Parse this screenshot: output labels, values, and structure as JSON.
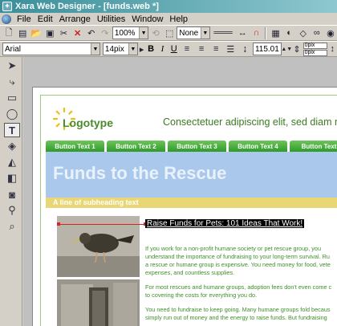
{
  "window": {
    "title": "Xara Web Designer - [funds.web *]"
  },
  "menu": [
    "File",
    "Edit",
    "Arrange",
    "Utilities",
    "Window",
    "Help"
  ],
  "toolbar": {
    "zoom": "100%",
    "fill": "None",
    "width_value": "115.01",
    "x_value": "0pix",
    "y_value": "0pix"
  },
  "textbar": {
    "font": "Arial",
    "size": "14pix",
    "bold": "B",
    "italic": "I",
    "underline": "U"
  },
  "tools": [
    "selector",
    "shape-editor",
    "rectangle",
    "ellipse",
    "text",
    "fill",
    "transparency",
    "shadow",
    "photo",
    "link",
    "zoom"
  ],
  "site": {
    "logotype": "Logotype",
    "tagline": "Consectetuer adipiscing elit, sed diam nonur",
    "nav": [
      "Button Text 1",
      "Button Text 2",
      "Button Text 3",
      "Button Text 4",
      "Button Text"
    ],
    "hero_title": "Funds to the Rescue",
    "subheading": "A line of subheading text",
    "headline": "Raise Funds for Pets: 101 Ideas That Work!",
    "paragraphs": [
      "If you work for a non-profit humane society or pet rescue group, you",
      "understand the importance of fundraising to your long-term survival. Ru",
      "a rescue or humane group is expensive. You need money for food, vete",
      "expenses, and countless supplies.",
      "For most rescues and humane groups, adoption fees don't even come c",
      "to covering the costs for everything you do.",
      "You need to fundraise to keep going. Many humane groups fold becaus",
      "simply run out of money and the energy to raise funds. But fundraising"
    ]
  },
  "colors": {
    "accent_green": "#3b7a22",
    "hero_blue": "#aac8ec",
    "subhead_yellow": "#e8d774"
  }
}
